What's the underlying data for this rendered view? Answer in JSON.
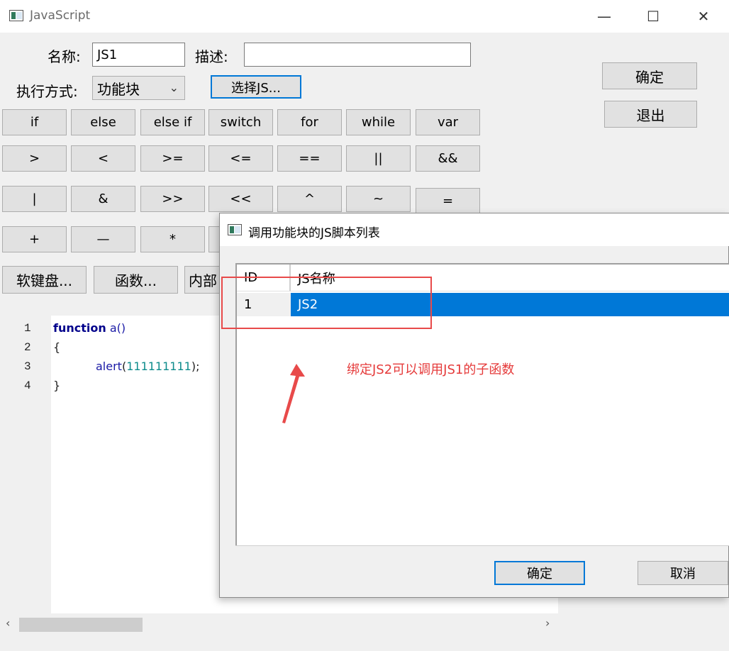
{
  "window": {
    "title": "JavaScript",
    "minimize": "—",
    "maximize": "☐",
    "close": "✕"
  },
  "form": {
    "name_label": "名称:",
    "name_value": "JS1",
    "desc_label": "描述:",
    "desc_value": "",
    "mode_label": "执行方式:",
    "mode_value": "功能块",
    "select_js_button": "选择JS...",
    "ok_button": "确定",
    "exit_button": "退出"
  },
  "keypad": {
    "row1": [
      "if",
      "else",
      "else if",
      "switch",
      "for",
      "while",
      "var"
    ],
    "row2": [
      ">",
      "<",
      ">=",
      "<=",
      "==",
      "||",
      "&&"
    ],
    "row3": [
      "|",
      "&",
      ">>",
      "<<",
      "^",
      "~",
      "="
    ],
    "row4": [
      "+",
      "—",
      "*"
    ]
  },
  "tools": {
    "soft_keyboard": "软键盘...",
    "functions": "函数...",
    "internal": "内部"
  },
  "editor": {
    "line_numbers": [
      "1",
      "2",
      "3",
      "4"
    ],
    "line1_kw": "function",
    "line1_rest": " a()",
    "line2": "{",
    "line3_fn": "alert",
    "line3_open": "(",
    "line3_num": "111111111",
    "line3_close": ");",
    "line4": "}"
  },
  "dialog": {
    "title": "调用功能块的JS脚本列表",
    "columns": [
      "ID",
      "JS名称"
    ],
    "rows": [
      {
        "id": "1",
        "name": "JS2"
      }
    ],
    "ok_button": "确定",
    "cancel_button": "取消"
  },
  "annotation": {
    "text": "绑定JS2可以调用JS1的子函数",
    "color": "#e53b3b"
  },
  "colors": {
    "selection": "#0078d7",
    "focus_border": "#0078d7",
    "annotation": "#e84a4a"
  }
}
